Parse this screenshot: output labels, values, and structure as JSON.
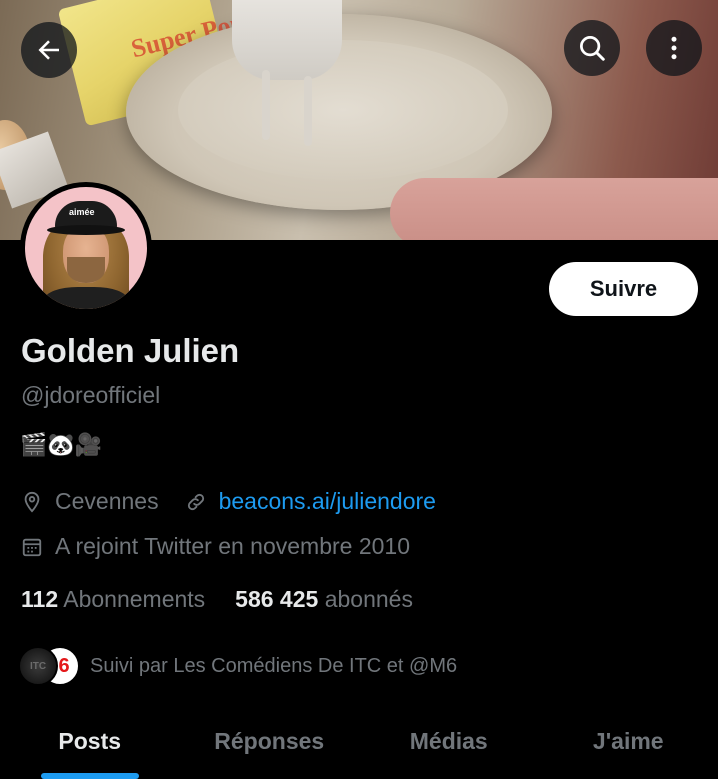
{
  "header": {
    "back_icon": "arrow-left-icon",
    "search_icon": "search-icon",
    "more_icon": "more-vertical-icon",
    "banner_text": "Super Poul"
  },
  "profile": {
    "avatar_hat_text": "aimée",
    "follow_label": "Suivre",
    "name": "Golden Julien",
    "handle": "@jdoreofficiel",
    "bio": "🎬🐼🎥",
    "location": "Cevennes",
    "link": "beacons.ai/juliendore",
    "joined": "A rejoint Twitter en novembre 2010"
  },
  "stats": {
    "following_count": "112",
    "following_label": "Abonnements",
    "followers_count": "586 425",
    "followers_label": "abonnés"
  },
  "followed_by": {
    "avatar1_text": "ITC",
    "avatar2_text": "6",
    "text": "Suivi par Les Comédiens De ITC et @M6"
  },
  "tabs": [
    {
      "label": "Posts",
      "active": true
    },
    {
      "label": "Réponses",
      "active": false
    },
    {
      "label": "Médias",
      "active": false
    },
    {
      "label": "J'aime",
      "active": false
    }
  ],
  "colors": {
    "background": "#000000",
    "text_primary": "#e7e9ea",
    "text_secondary": "#71767b",
    "accent": "#1d9bf0",
    "follow_button_bg": "#ffffff"
  }
}
